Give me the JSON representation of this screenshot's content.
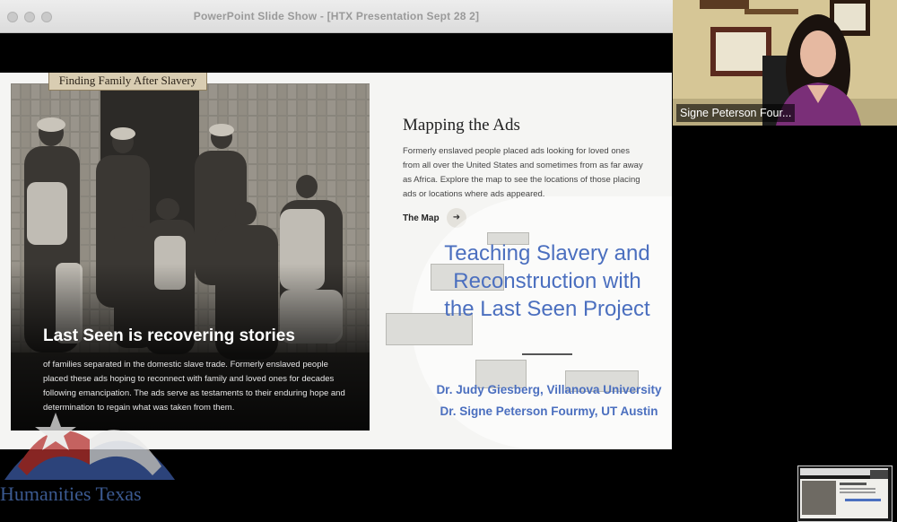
{
  "window": {
    "title": "PowerPoint Slide Show - [HTX Presentation Sept 28 2]"
  },
  "slide": {
    "label_tag": "Finding Family After Slavery",
    "photo_heading": "Last Seen is recovering stories",
    "photo_body": "of families separated in the domestic slave trade. Formerly enslaved people placed these ads hoping to reconnect with family and loved ones for decades following emancipation. The ads serve as testaments to their enduring hope and determination to regain what was taken from them.",
    "map_heading": "Mapping the Ads",
    "map_body": "Formerly enslaved people placed ads looking for loved ones from all over the United States and sometimes from as far away as Africa. Explore the map to see the locations of those placing ads or locations where ads appeared.",
    "map_link": "The Map",
    "map_arrow_icon": "arrow-right-icon",
    "overlay_title": "Teaching Slavery and Reconstruction with the Last Seen Project",
    "author1": "Dr. Judy Giesberg, Villanova University",
    "author2": "Dr. Signe Peterson Fourmy, UT Austin"
  },
  "watermark": {
    "text": "Humanities Texas"
  },
  "webcam": {
    "participant_name": "Signe Peterson Four..."
  },
  "colors": {
    "accent_blue": "#4b6fbf",
    "flag_red": "#b5322f",
    "flag_blue": "#3b5aa3"
  }
}
